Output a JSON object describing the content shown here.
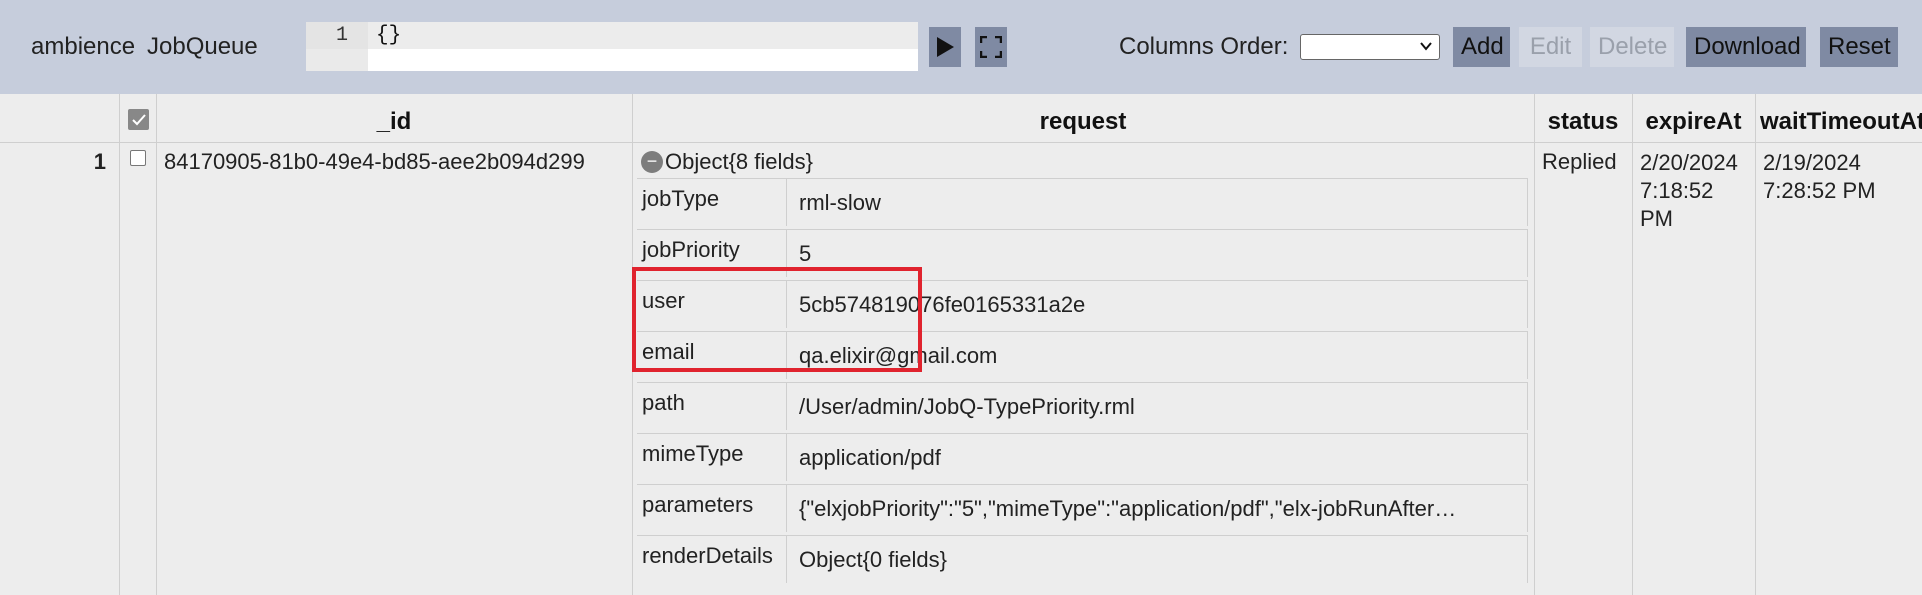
{
  "toolbar": {
    "database": "ambience",
    "collection": "JobQueue",
    "query_line_number": "1",
    "query_text": "{}",
    "columns_order_label": "Columns Order:",
    "columns_order_value": "",
    "buttons": {
      "add": "Add",
      "edit": "Edit",
      "delete": "Delete",
      "download": "Download",
      "reset": "Reset"
    },
    "icons": {
      "run": "play-icon",
      "fullscreen": "fullscreen-icon"
    },
    "colors": {
      "bar_bg": "#c6cddc",
      "button_on": "#7f8aa3",
      "button_off": "#d2d7e2"
    }
  },
  "grid": {
    "columns": [
      "_id",
      "request",
      "status",
      "expireAt",
      "waitTimeoutAt"
    ],
    "rows": [
      {
        "row_number": "1",
        "id": "84170905-81b0-49e4-bd85-aee2b094d299",
        "request_summary": "Object{8 fields}",
        "request_fields": [
          {
            "key": "jobType",
            "value": "rml-slow"
          },
          {
            "key": "jobPriority",
            "value": "5"
          },
          {
            "key": "user",
            "value": "5cb574819076fe0165331a2e"
          },
          {
            "key": "email",
            "value": "qa.elixir@gmail.com"
          },
          {
            "key": "path",
            "value": "/User/admin/JobQ-TypePriority.rml"
          },
          {
            "key": "mimeType",
            "value": "application/pdf"
          },
          {
            "key": "parameters",
            "value": "{\"elxjobPriority\":\"5\",\"mimeType\":\"application/pdf\",\"elx-jobRunAfter…"
          },
          {
            "key": "renderDetails",
            "value": "Object{0 fields}"
          }
        ],
        "status": "Replied",
        "expireAt": [
          "2/20/2024",
          "7:18:52",
          "PM"
        ],
        "waitTimeoutAt": [
          "2/19/2024",
          "7:28:52 PM"
        ]
      }
    ],
    "highlight_color": "#e0232e"
  }
}
